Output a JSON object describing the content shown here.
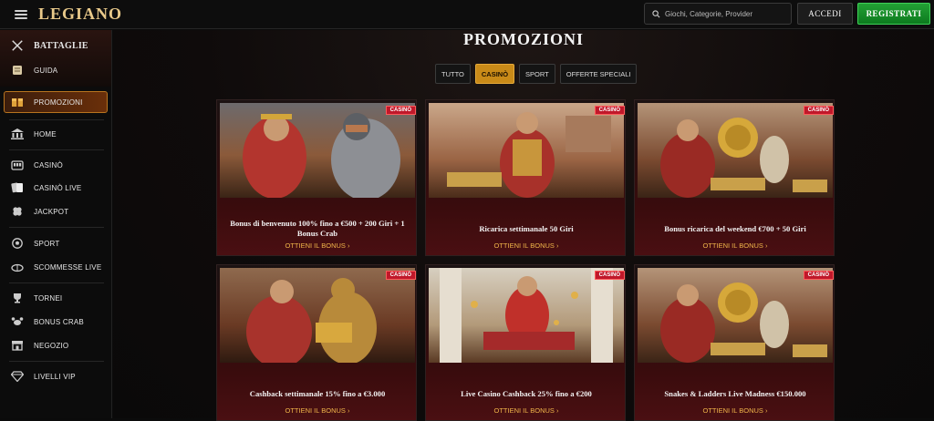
{
  "header": {
    "logo": "LEGIANO",
    "search_placeholder": "Giochi, Categorie, Provider",
    "login": "ACCEDI",
    "register": "REGISTRATI"
  },
  "sidebar": {
    "items": [
      {
        "label": "BATTAGLIE",
        "icon": "crossed-swords-icon"
      },
      {
        "label": "GUIDA",
        "icon": "scroll-icon"
      },
      {
        "label": "PROMOZIONI",
        "icon": "gift-icon",
        "active": true
      },
      {
        "label": "HOME",
        "icon": "temple-icon"
      },
      {
        "label": "CASINÒ",
        "icon": "slot-machine-icon"
      },
      {
        "label": "CASINÒ LIVE",
        "icon": "cards-icon"
      },
      {
        "label": "JACKPOT",
        "icon": "clover-icon"
      },
      {
        "label": "SPORT",
        "icon": "ball-icon"
      },
      {
        "label": "SCOMMESSE LIVE",
        "icon": "stadium-icon"
      },
      {
        "label": "TORNEI",
        "icon": "trophy-icon"
      },
      {
        "label": "BONUS CRAB",
        "icon": "crab-icon"
      },
      {
        "label": "NEGOZIO",
        "icon": "shop-icon"
      },
      {
        "label": "LIVELLI VIP",
        "icon": "diamond-icon"
      }
    ]
  },
  "main": {
    "title": "PROMOZIONI",
    "tabs": [
      "TUTTO",
      "CASINÒ",
      "SPORT",
      "OFFERTE SPECIALI"
    ],
    "active_tab": "CASINÒ",
    "cards": [
      {
        "badge": "CASINÒ",
        "title": "Bonus di benvenuto 100% fino a €500 + 200 Giri + 1 Bonus Crab",
        "cta": "OTTIENI IL BONUS"
      },
      {
        "badge": "CASINÒ",
        "title": "Ricarica settimanale 50 Giri",
        "cta": "OTTIENI IL BONUS"
      },
      {
        "badge": "CASINÒ",
        "title": "Bonus ricarica del weekend €700 + 50 Giri",
        "cta": "OTTIENI IL BONUS"
      },
      {
        "badge": "CASINÒ",
        "title": "Cashback settimanale 15% fino a €3.000",
        "cta": "OTTIENI IL BONUS"
      },
      {
        "badge": "CASINÒ",
        "title": "Live Casino Cashback 25% fino a €200",
        "cta": "OTTIENI IL BONUS"
      },
      {
        "badge": "CASINÒ",
        "title": "Snakes & Ladders Live Madness €150.000",
        "cta": "OTTIENI IL BONUS"
      }
    ]
  },
  "colors": {
    "accent": "#c98a18",
    "register": "#1a9a30",
    "badge": "#c0182a",
    "cta": "#f0b54a"
  }
}
